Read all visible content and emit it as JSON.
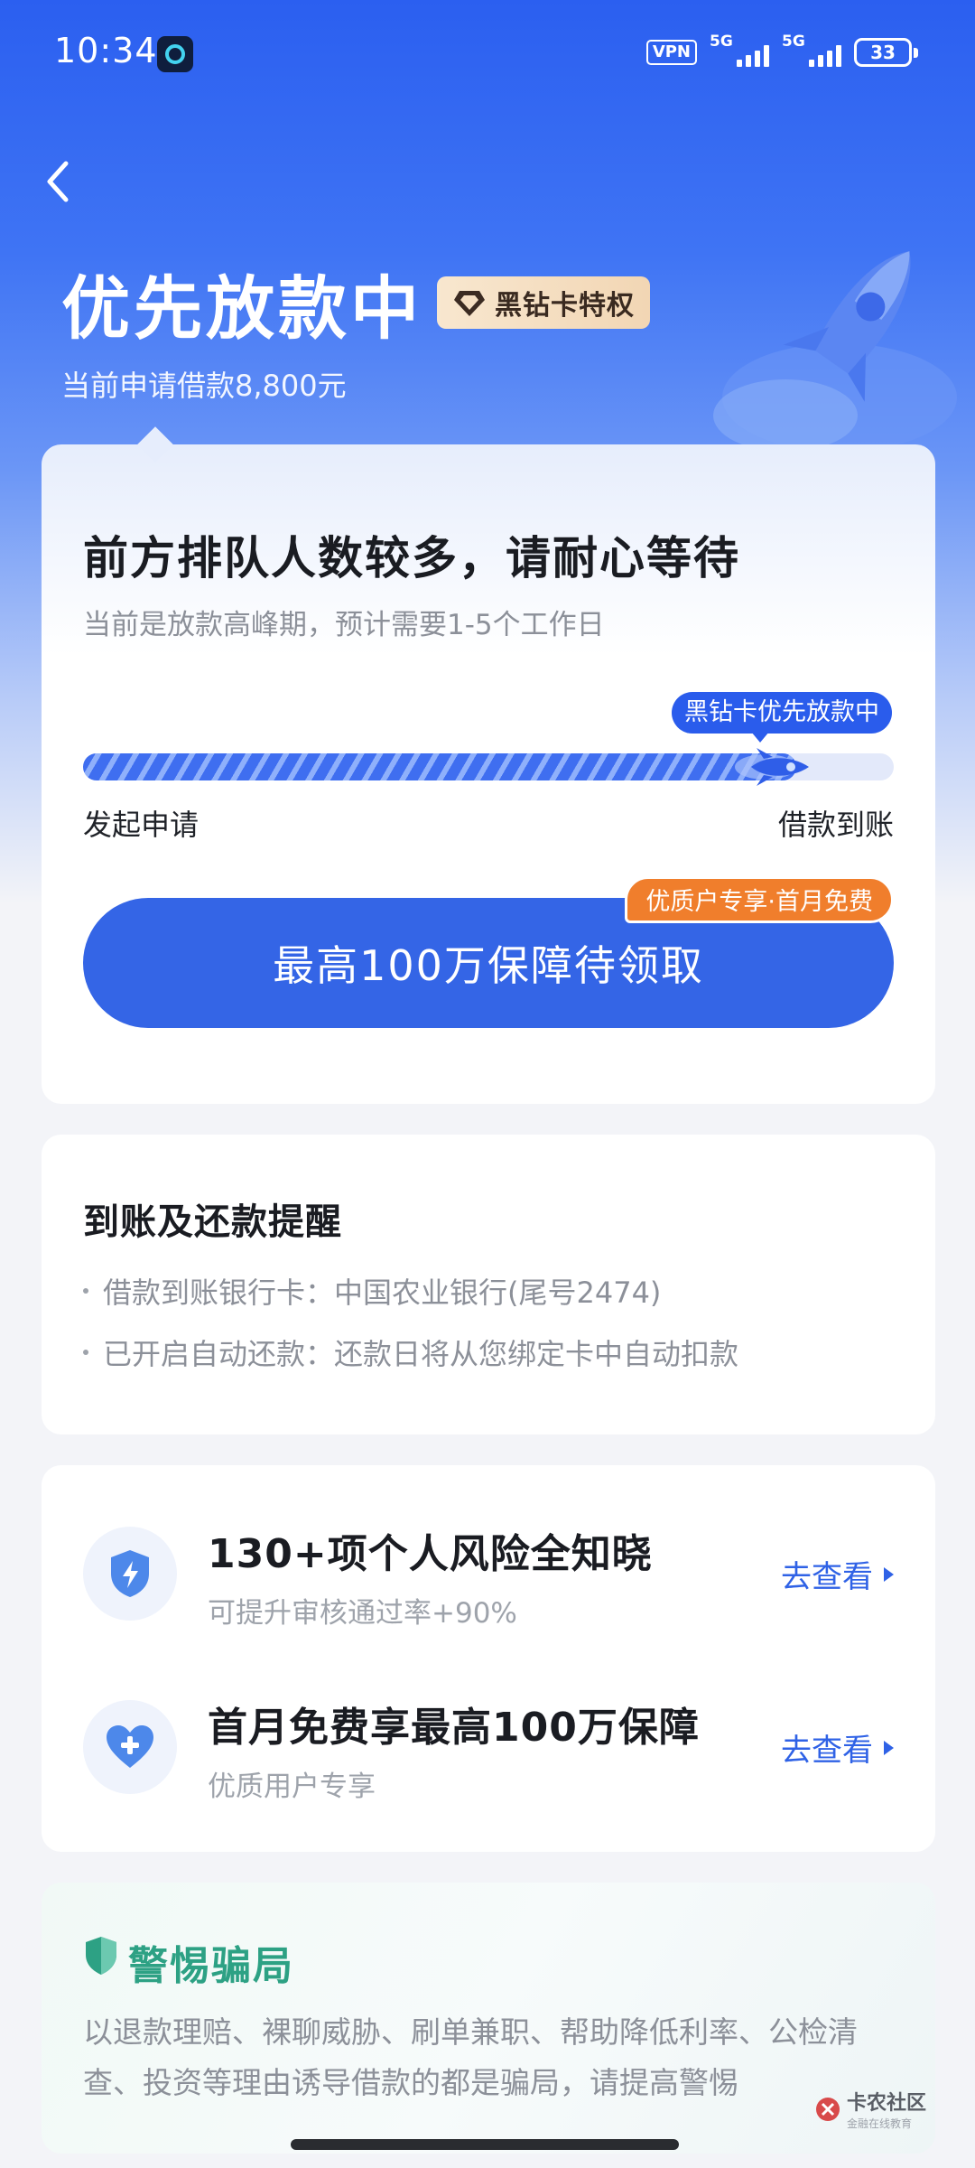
{
  "status_bar": {
    "time": "10:34",
    "vpn": "VPN",
    "signal_1": "5G",
    "signal_2": "5G",
    "battery": "33"
  },
  "header": {
    "title": "优先放款中",
    "badge": "黑钻卡特权",
    "subtitle": "当前申请借款8,800元"
  },
  "status_card": {
    "heading": "前方排队人数较多，请耐心等待",
    "subheading": "当前是放款高峰期，预计需要1-5个工作日",
    "tooltip": "黑钻卡优先放款中",
    "progress_fraction": 0.88,
    "start_label": "发起申请",
    "end_label": "借款到账",
    "cta_label": "最高100万保障待领取",
    "cta_tag": "优质户专享·首月免费"
  },
  "reminder": {
    "title": "到账及还款提醒",
    "items": [
      "借款到账银行卡：中国农业银行(尾号2474)",
      "已开启自动还款：还款日将从您绑定卡中自动扣款"
    ]
  },
  "services": [
    {
      "icon": "shield-bolt-icon",
      "title": "130+项个人风险全知晓",
      "subtitle": "可提升审核通过率+90%",
      "link": "去查看"
    },
    {
      "icon": "heart-plus-icon",
      "title": "首月免费享最高100万保障",
      "subtitle": "优质用户专享",
      "link": "去查看"
    }
  ],
  "warning": {
    "title": "警惕骗局",
    "text": "以退款理赔、裸聊威胁、刷单兼职、帮助降低利率、公检清查、投资等理由诱导借款的都是骗局，请提高警惕"
  },
  "watermark": {
    "main": "卡农社区",
    "sub": "金融在线教育"
  },
  "colors": {
    "primary": "#3465e6",
    "accent_orange": "#f07e2c",
    "warning_green": "#2da184"
  }
}
